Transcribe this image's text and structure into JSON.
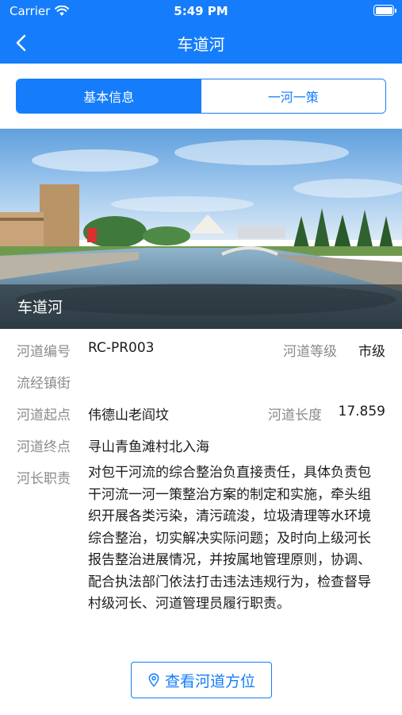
{
  "status_bar": {
    "carrier": "Carrier",
    "time": "5:49 PM"
  },
  "nav": {
    "title": "车道河"
  },
  "tabs": [
    {
      "label": "基本信息",
      "active": true
    },
    {
      "label": "一河一策",
      "active": false
    }
  ],
  "hero": {
    "caption": "车道河"
  },
  "info": {
    "code_label": "河道编号",
    "code_value": "RC-PR003",
    "grade_label": "河道等级",
    "grade_value": "市级",
    "towns_label": "流经镇街",
    "towns_value": "",
    "start_label": "河道起点",
    "start_value": "伟德山老阎坟",
    "length_label": "河道长度",
    "length_value": "17.859",
    "end_label": "河道终点",
    "end_value": "寻山青鱼滩村北入海",
    "duty_label": "河长职责",
    "duty_value": "对包干河流的综合整治负直接责任，具体负责包干河流一河一策整治方案的制定和实施，牵头组织开展各类污染，清污疏浚，垃圾清理等水环境综合整治，切实解决实际问题；及时向上级河长报告整治进展情况，并按属地管理原则，协调、配合执法部门依法打击违法违规行为，检查督导村级河长、河道管理员履行职责。"
  },
  "actions": {
    "view_location": "查看河道方位"
  },
  "colors": {
    "primary": "#157dfb",
    "label_gray": "#8a8a8a"
  },
  "icons": {
    "back": "chevron-left-icon",
    "wifi": "wifi-icon",
    "battery": "battery-icon",
    "location": "location-pin-icon"
  }
}
